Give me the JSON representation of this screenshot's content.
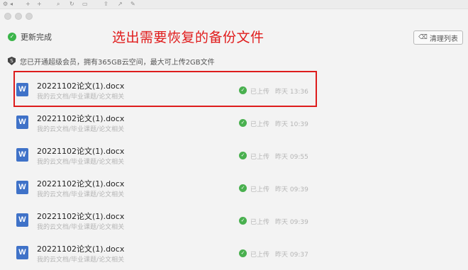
{
  "toolbar": {
    "icons": [
      "settings-icon",
      "back-icon",
      "add-icon",
      "add-icon",
      "zoom-icon",
      "refresh-icon",
      "screen-icon",
      "share-icon",
      "export-icon",
      "tools-icon"
    ]
  },
  "status": {
    "text": "更新完成"
  },
  "annotation": {
    "text": "选出需要恢复的备份文件",
    "color": "#e01b1b"
  },
  "clear_button": {
    "label": "清理列表"
  },
  "info": {
    "text": "您已开通超级会员，拥有365GB云空间，最大可上传2GB文件"
  },
  "files": [
    {
      "name": "20221102论文(1).docx",
      "path": "我的云文档/毕业课题/论文相关",
      "status": "已上传",
      "time": "昨天 13:36"
    },
    {
      "name": "20221102论文(1).docx",
      "path": "我的云文档/毕业课题/论文相关",
      "status": "已上传",
      "time": "昨天 10:39"
    },
    {
      "name": "20221102论文(1).docx",
      "path": "我的云文档/毕业课题/论文相关",
      "status": "已上传",
      "time": "昨天 09:55"
    },
    {
      "name": "20221102论文(1).docx",
      "path": "我的云文档/毕业课题/论文相关",
      "status": "已上传",
      "time": "昨天 09:39"
    },
    {
      "name": "20221102论文(1).docx",
      "path": "我的云文档/毕业课题/论文相关",
      "status": "已上传",
      "time": "昨天 09:39"
    },
    {
      "name": "20221102论文(1).docx",
      "path": "我的云文档/毕业课题/论文相关",
      "status": "已上传",
      "time": "昨天 09:37"
    }
  ],
  "colors": {
    "accent_red": "#dd1c1c",
    "success_green": "#3bb54a",
    "doc_blue": "#3f72c8"
  }
}
